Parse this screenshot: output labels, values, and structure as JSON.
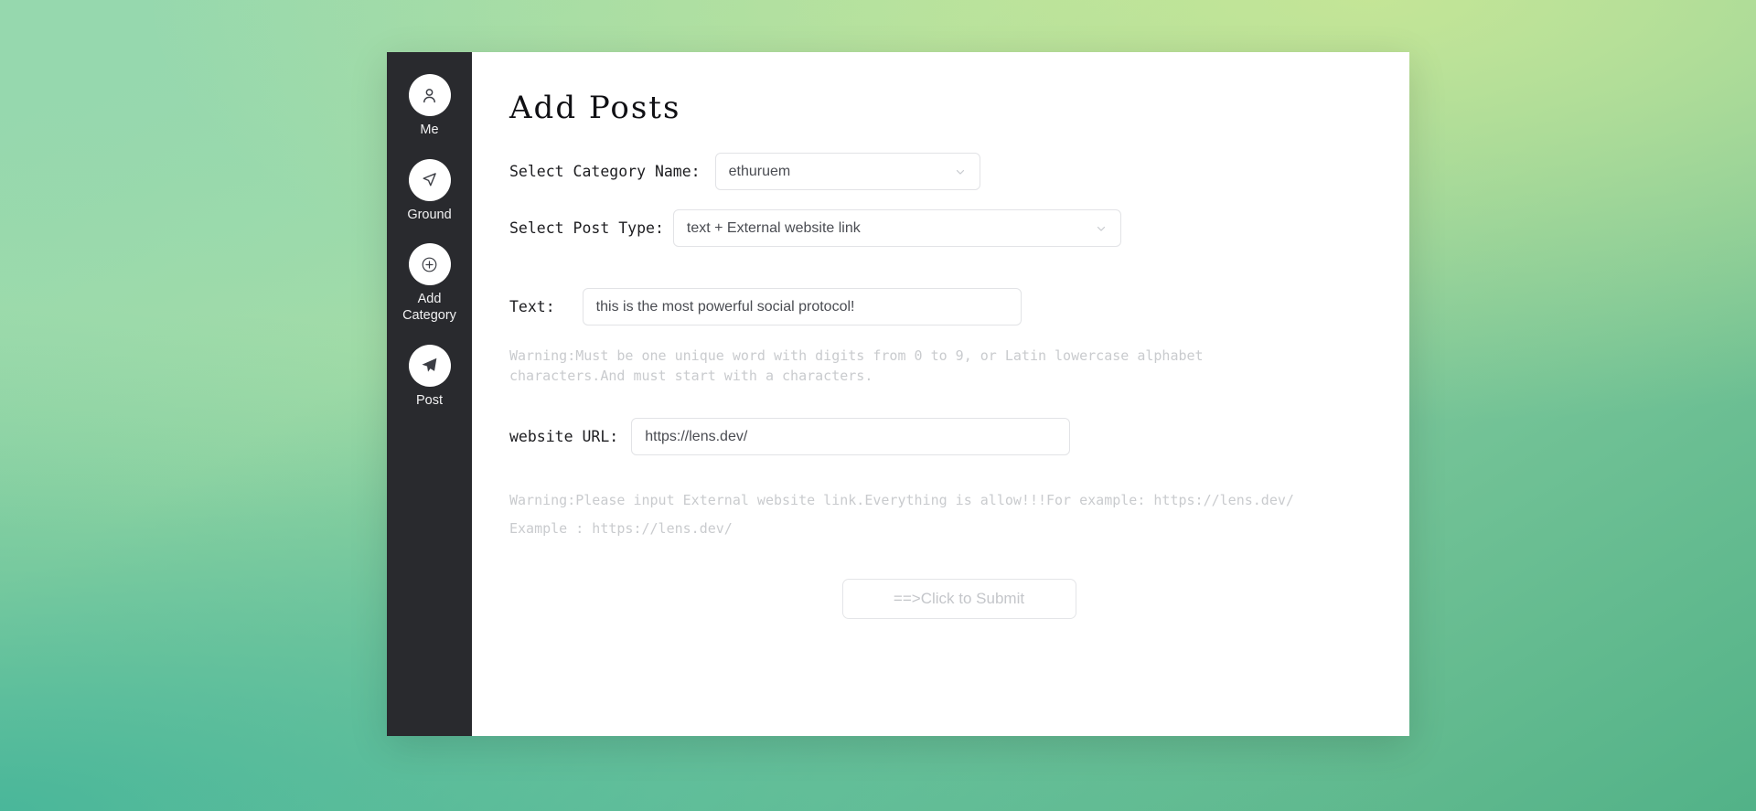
{
  "theme": {
    "sidebar_bg": "#292a2e",
    "card_bg": "#ffffff",
    "border": "#e2e3e6",
    "muted_text": "#c9cbce",
    "body_text": "#4a4c52"
  },
  "sidebar": {
    "items": [
      {
        "label": "Me",
        "icon": "user-icon"
      },
      {
        "label": "Ground",
        "icon": "navigation-arrow-icon"
      },
      {
        "label": "Add Category",
        "icon": "plus-circle-icon"
      },
      {
        "label": "Post",
        "icon": "send-plane-icon"
      }
    ]
  },
  "main": {
    "title": "Add Posts",
    "fields": {
      "category": {
        "label": "Select Category Name:",
        "value": "ethuruem",
        "chevron": "chevron-down-icon"
      },
      "post_type": {
        "label": "Select Post Type:",
        "value": "text + External website link",
        "chevron": "chevron-down-icon"
      },
      "text": {
        "label": "Text:",
        "value": "this is the most powerful social protocol!",
        "warning": "Warning:Must be one unique word with digits from 0 to 9, or Latin lowercase alphabet characters.And must start with a characters."
      },
      "website_url": {
        "label": "website URL:",
        "value": "https://lens.dev/",
        "warning_line1": "Warning:Please input External website link.Everything is allow!!!For example: https://lens.dev/",
        "warning_line2": "Example : https://lens.dev/"
      }
    },
    "submit_label": "==>Click to Submit"
  }
}
